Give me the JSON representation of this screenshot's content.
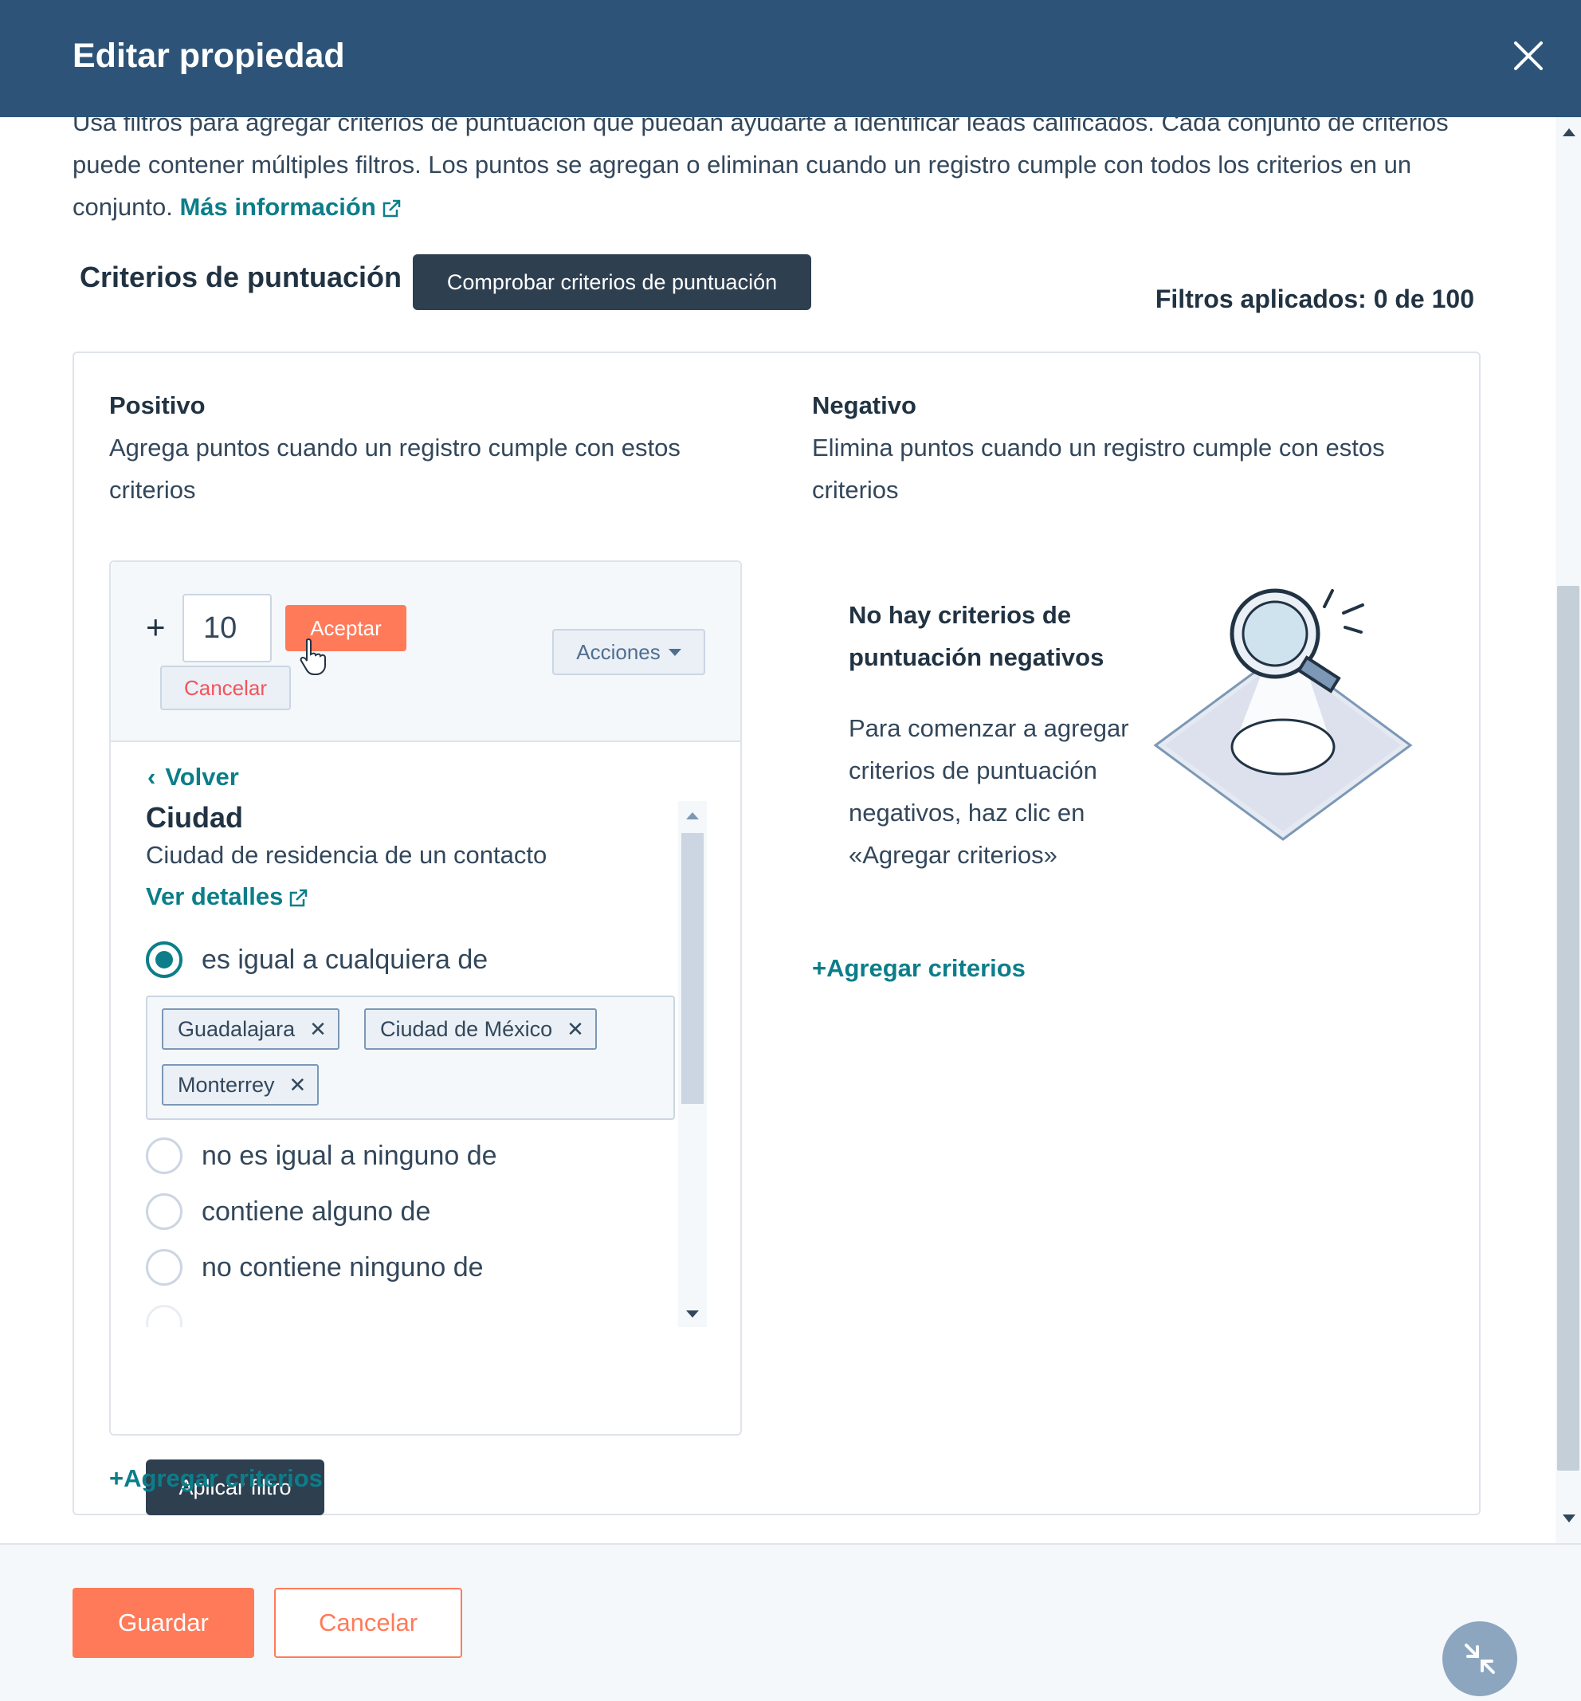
{
  "modal": {
    "title": "Editar propiedad"
  },
  "intro": {
    "text_line1": "Usa filtros para agregar criterios de puntuación que puedan ayudarte a identificar leads calificados. Cada conjunto de criterios",
    "text_line2": "puede contener múltiples filtros. Los puntos se agregan o eliminan cuando un registro cumple con todos los criterios en un",
    "text_line3": "conjunto. ",
    "learn_more": "Más información"
  },
  "scoring": {
    "title": "Criterios de puntuación",
    "check_button": "Comprobar criterios de puntuación",
    "filters_applied": "Filtros aplicados: 0 de 100"
  },
  "positive": {
    "heading": "Positivo",
    "description_line1": "Agrega puntos cuando un registro cumple con estos",
    "description_line2": "criterios",
    "plus": "+",
    "points_value": "10",
    "accept": "Aceptar",
    "cancel": "Cancelar",
    "actions": "Acciones",
    "back": "Volver",
    "property": {
      "name": "Ciudad",
      "description": "Ciudad de residencia de un contacto",
      "details_link": "Ver detalles"
    },
    "operators": [
      {
        "label": "es igual a cualquiera de",
        "checked": true
      },
      {
        "label": "no es igual a ninguno de",
        "checked": false
      },
      {
        "label": "contiene alguno de",
        "checked": false
      },
      {
        "label": "no contiene ninguno de",
        "checked": false
      }
    ],
    "tags": [
      "Guadalajara",
      "Ciudad de México",
      "Monterrey"
    ],
    "apply_filter": "Aplicar filtro",
    "add_criteria": "+Agregar criterios"
  },
  "negative": {
    "heading": "Negativo",
    "description_line1": "Elimina puntos cuando un registro cumple con estos",
    "description_line2": "criterios",
    "empty_title_line1": "No hay criterios de",
    "empty_title_line2": "puntuación negativos",
    "empty_desc_line1": "Para comenzar a agregar",
    "empty_desc_line2": "criterios de puntuación",
    "empty_desc_line3": "negativos, haz clic en",
    "empty_desc_line4": "«Agregar criterios»",
    "add_criteria": "+Agregar criterios"
  },
  "footer": {
    "save": "Guardar",
    "cancel": "Cancelar"
  },
  "colors": {
    "header_bg": "#2d5478",
    "accent_orange": "#ff7a59",
    "link_teal": "#0b7e8a",
    "dark_button": "#2e3f50"
  }
}
